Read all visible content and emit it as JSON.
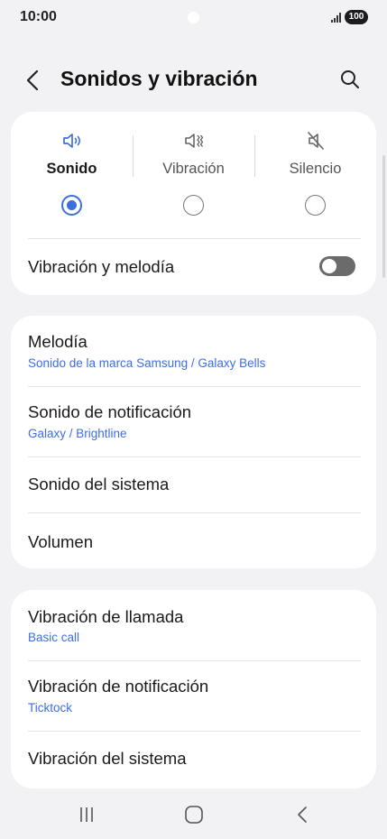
{
  "status_bar": {
    "time": "10:00",
    "battery": "100"
  },
  "header": {
    "title": "Sonidos y vibración"
  },
  "sound_mode": {
    "options": [
      {
        "label": "Sonido",
        "icon": "speaker-icon",
        "selected": true
      },
      {
        "label": "Vibración",
        "icon": "vibrate-icon",
        "selected": false
      },
      {
        "label": "Silencio",
        "icon": "mute-icon",
        "selected": false
      }
    ],
    "vibrate_with_ringtone": {
      "label": "Vibración y melodía",
      "enabled": false
    }
  },
  "sound_settings": {
    "items": [
      {
        "title": "Melodía",
        "subtitle": "Sonido de la marca Samsung / Galaxy Bells"
      },
      {
        "title": "Sonido de notificación",
        "subtitle": "Galaxy / Brightline"
      },
      {
        "title": "Sonido del sistema"
      },
      {
        "title": "Volumen"
      }
    ]
  },
  "vibration_settings": {
    "items": [
      {
        "title": "Vibración de llamada",
        "subtitle": "Basic call"
      },
      {
        "title": "Vibración de notificación",
        "subtitle": "Ticktock"
      },
      {
        "title": "Vibración del sistema"
      }
    ]
  },
  "colors": {
    "accent": "#3d6fdc",
    "background": "#f2f2f4",
    "card": "#ffffff"
  }
}
